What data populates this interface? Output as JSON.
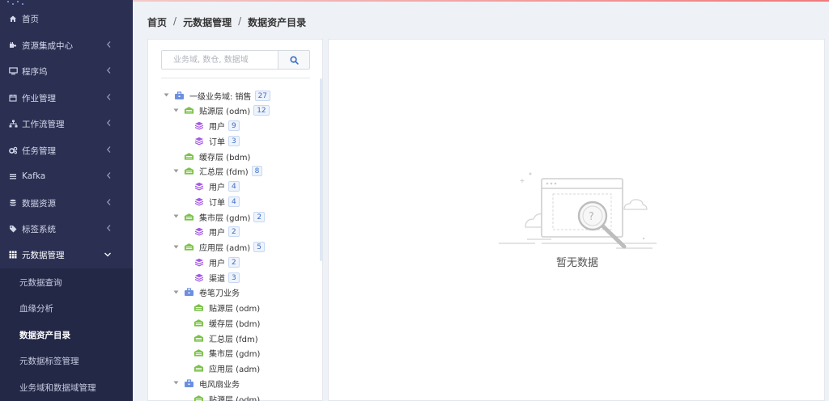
{
  "sidebar": {
    "items": [
      {
        "label": "首页",
        "icon": "home-icon",
        "expandable": false
      },
      {
        "label": "资源集成中心",
        "icon": "plug-icon",
        "expandable": true
      },
      {
        "label": "程序坞",
        "icon": "monitor-icon",
        "expandable": true
      },
      {
        "label": "作业管理",
        "icon": "calendar-icon",
        "expandable": true
      },
      {
        "label": "工作流管理",
        "icon": "sitemap-icon",
        "expandable": true
      },
      {
        "label": "任务管理",
        "icon": "cogs-icon",
        "expandable": true
      },
      {
        "label": "Kafka",
        "icon": "list-icon",
        "expandable": true
      },
      {
        "label": "数据资源",
        "icon": "database-icon",
        "expandable": true
      },
      {
        "label": "标签系统",
        "icon": "tag-icon",
        "expandable": true
      },
      {
        "label": "元数据管理",
        "icon": "grid-icon",
        "expandable": true,
        "open": true
      }
    ],
    "submenu": [
      {
        "label": "元数据查询"
      },
      {
        "label": "血缘分析"
      },
      {
        "label": "数据资产目录",
        "active": true
      },
      {
        "label": "元数据标签管理"
      },
      {
        "label": "业务域和数据域管理"
      }
    ]
  },
  "breadcrumb": {
    "items": [
      "首页",
      "元数据管理",
      "数据资产目录"
    ],
    "separator": "/"
  },
  "tree": {
    "search_placeholder": "业务域, 数仓, 数据域",
    "nodes": [
      {
        "label": "一级业务域: 销售",
        "count": "27",
        "type": "business",
        "level": 0,
        "caret": true
      },
      {
        "label": "贴源层 (odm)",
        "count": "12",
        "type": "layer",
        "level": 1,
        "caret": true
      },
      {
        "label": "用户",
        "count": "9",
        "type": "domain",
        "level": 2
      },
      {
        "label": "订单",
        "count": "3",
        "type": "domain",
        "level": 2
      },
      {
        "label": "缓存层 (bdm)",
        "count": "",
        "type": "layer",
        "level": 1
      },
      {
        "label": "汇总层 (fdm)",
        "count": "8",
        "type": "layer",
        "level": 1,
        "caret": true
      },
      {
        "label": "用户",
        "count": "4",
        "type": "domain",
        "level": 2
      },
      {
        "label": "订单",
        "count": "4",
        "type": "domain",
        "level": 2
      },
      {
        "label": "集市层 (gdm)",
        "count": "2",
        "type": "layer",
        "level": 1,
        "caret": true
      },
      {
        "label": "用户",
        "count": "2",
        "type": "domain",
        "level": 2
      },
      {
        "label": "应用层 (adm)",
        "count": "5",
        "type": "layer",
        "level": 1,
        "caret": true
      },
      {
        "label": "用户",
        "count": "2",
        "type": "domain",
        "level": 2
      },
      {
        "label": "渠道",
        "count": "3",
        "type": "domain",
        "level": 2
      },
      {
        "label": "卷笔刀业务",
        "count": "",
        "type": "business",
        "level": 1,
        "caret": true
      },
      {
        "label": "贴源层 (odm)",
        "count": "",
        "type": "layer",
        "level": 2
      },
      {
        "label": "缓存层 (bdm)",
        "count": "",
        "type": "layer",
        "level": 2
      },
      {
        "label": "汇总层 (fdm)",
        "count": "",
        "type": "layer",
        "level": 2
      },
      {
        "label": "集市层 (gdm)",
        "count": "",
        "type": "layer",
        "level": 2
      },
      {
        "label": "应用层 (adm)",
        "count": "",
        "type": "layer",
        "level": 2
      },
      {
        "label": "电风扇业务",
        "count": "",
        "type": "business",
        "level": 1,
        "caret": true
      },
      {
        "label": "贴源层 (odm)",
        "count": "",
        "type": "layer",
        "level": 2
      }
    ]
  },
  "main": {
    "empty_text": "暂无数据"
  },
  "colors": {
    "sidebar_bg": "#2b2f52",
    "submenu_bg": "#242847",
    "accent": "#3b6fc6",
    "layer_icon": "#7cc24a",
    "domain_icon": "#a55ae6",
    "business_icon": "#6c8fe0"
  }
}
